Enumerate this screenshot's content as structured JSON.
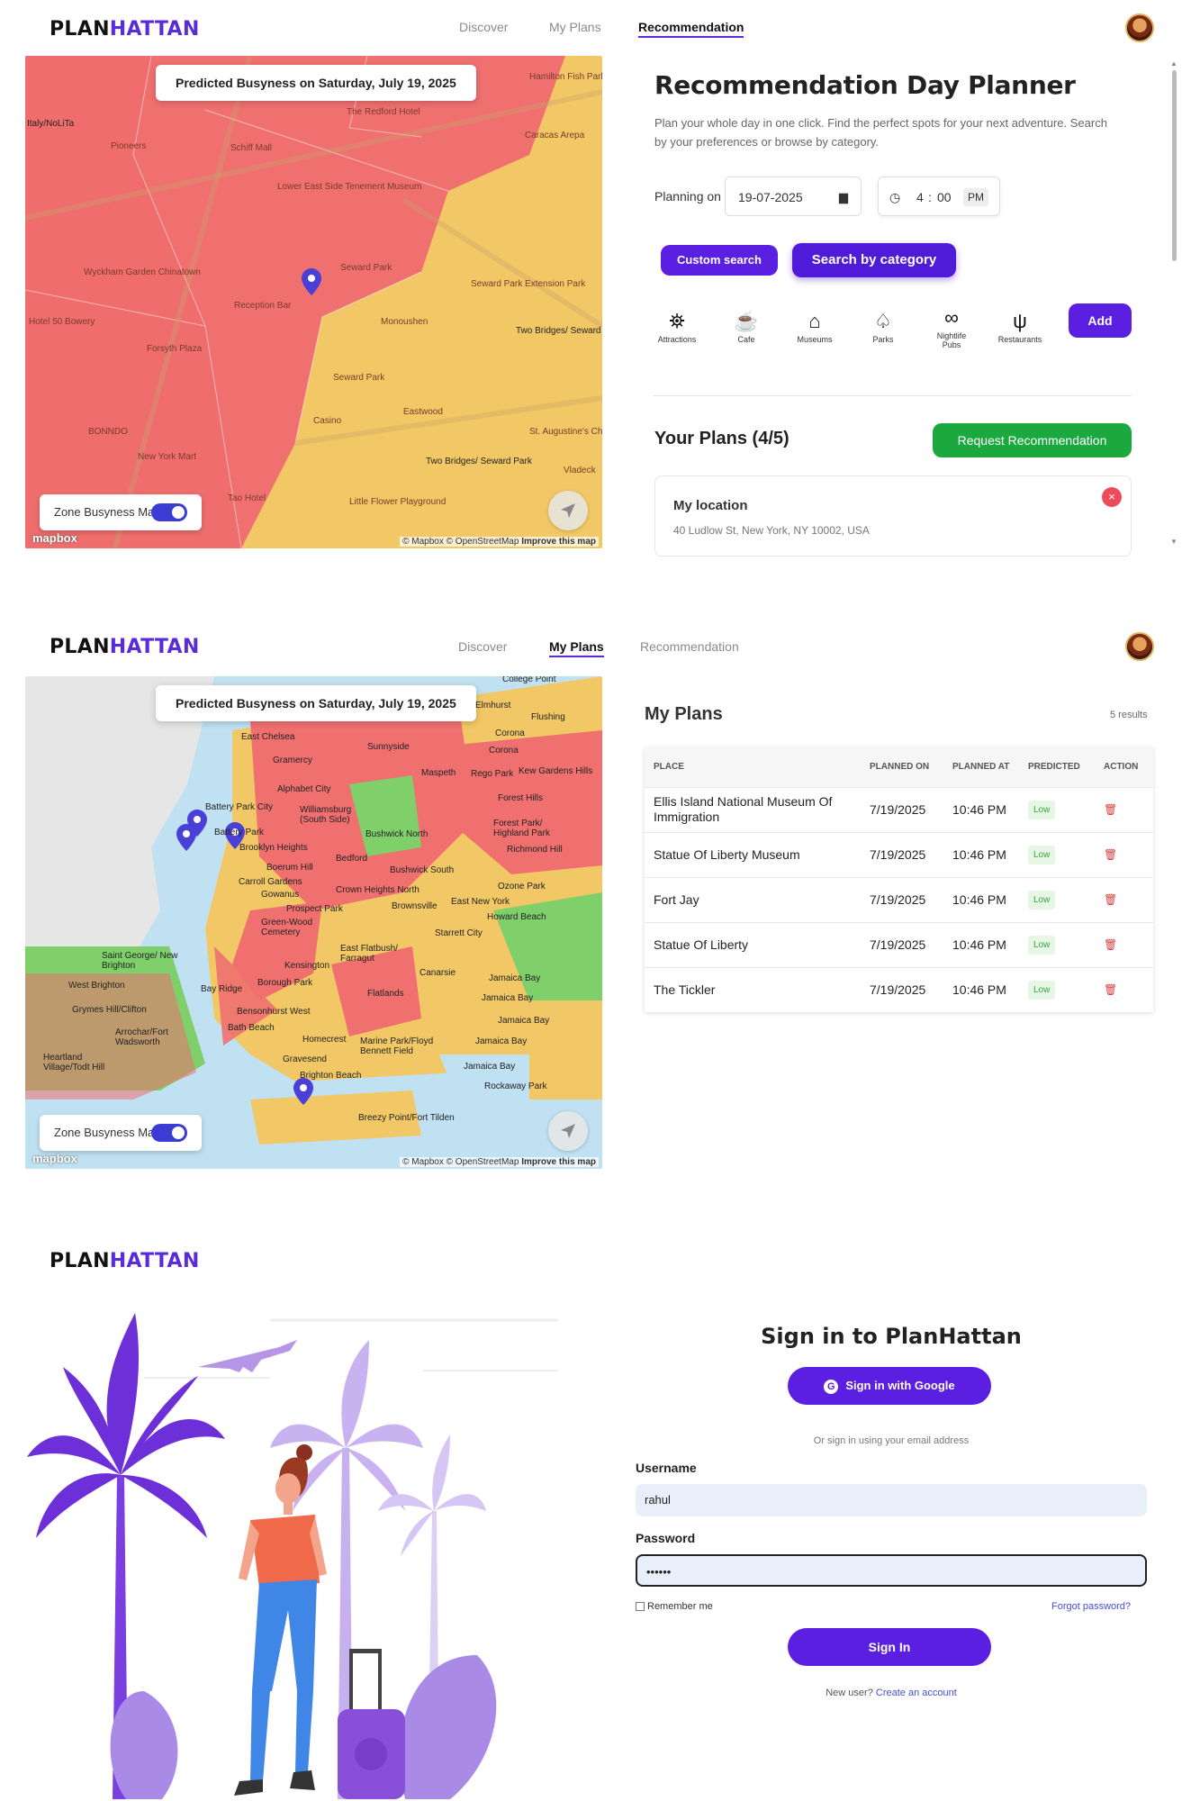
{
  "brand": {
    "part1": "PLAN",
    "part2": "HATTAN"
  },
  "nav": {
    "discover": "Discover",
    "my_plans": "My Plans",
    "recommendation": "Recommendation"
  },
  "map": {
    "busyness_label": "Predicted Busyness on Saturday, July 19, 2025",
    "toggle_label": "Zone Busyness Map",
    "attribution_mapbox": "© Mapbox",
    "attribution_osm": "© OpenStreetMap",
    "attribution_improve": "Improve this map",
    "logo": "mapbox",
    "map1_labels": [
      "Seward Park",
      "Monoushen",
      "Two Bridges/ Seward Park",
      "Forsyth Plaza",
      "Little Flower Playground",
      "Seward Park Extension Park",
      "Eastwood",
      "Casino",
      "St. Augustine's Church",
      "Two Bridges/ Seward Park",
      "Vladeck",
      "Schiff Mall",
      "The Redford Hotel",
      "Lower East Side Tenement Museum",
      "Wyckham Garden Chinatown",
      "New York Mart",
      "Reception Bar",
      "Hotel 50 Bowery",
      "BONNDO",
      "Pioneers",
      "Caracas Arepa",
      "Tao Hotel",
      "Italy/NoLiTa",
      "Hamilton Fish Park",
      "Seward Park"
    ],
    "map2_labels": [
      "College Point",
      "Elmhurst",
      "Flushing",
      "East Chelsea",
      "Corona",
      "Sunnyside",
      "Gramercy",
      "Corona",
      "Maspeth",
      "Rego Park",
      "Kew Gardens Hills",
      "Alphabet City",
      "Battery Park City",
      "Williamsburg (South Side)",
      "Forest Hills",
      "Battery Park",
      "Forest Park/ Highland Park",
      "Bushwick North",
      "Brooklyn Heights",
      "Richmond Hill",
      "Bedford",
      "Boerum Hill",
      "Bushwick South",
      "Carroll Gardens",
      "Gowanus",
      "Crown Heights North",
      "Ozone Park",
      "Prospect Park",
      "Brownsville",
      "East New York",
      "Green-Wood Cemetery",
      "Howard Beach",
      "Saint George/ New Brighton",
      "Starrett City",
      "East Flatbush/ Farragut",
      "Kensington",
      "Canarsie",
      "Borough Park",
      "Jamaica Bay",
      "West Brighton",
      "Bay Ridge",
      "Flatlands",
      "Jamaica Bay",
      "Grymes Hill/Clifton",
      "Bensonhurst West",
      "Bath Beach",
      "Jamaica Bay",
      "Arrochar/Fort Wadsworth",
      "Homecrest",
      "Marine Park/Floyd Bennett Field",
      "Jamaica Bay",
      "Heartland Village/Todt Hill",
      "Gravesend",
      "Brighton Beach",
      "Jamaica Bay",
      "Rockaway Park",
      "Breezy Point/Fort Tilden"
    ]
  },
  "planner": {
    "title": "Recommendation Day Planner",
    "subtitle": "Plan your whole day in one click. Find the perfect spots for your next adventure. Search by your preferences or browse by category.",
    "planning_on": "Planning on",
    "date": "19-07-2025",
    "time_hour": "4",
    "time_min": "00",
    "time_ampm": "PM",
    "custom_search": "Custom search",
    "search_by_category": "Search by category",
    "add": "Add",
    "categories": [
      {
        "label": "Attractions",
        "icon": "binoculars-icon"
      },
      {
        "label": "Cafe",
        "icon": "coffee-icon"
      },
      {
        "label": "Museums",
        "icon": "museum-icon"
      },
      {
        "label": "Parks",
        "icon": "tree-icon"
      },
      {
        "label": "Nightlife Pubs",
        "icon": "glasses-icon"
      },
      {
        "label": "Restaurants",
        "icon": "utensils-icon"
      }
    ],
    "your_plans": "Your Plans (4/5)",
    "request_recommendation": "Request Recommendation",
    "location_title": "My location",
    "location_address": "40 Ludlow St, New York, NY 10002, USA"
  },
  "my_plans": {
    "title": "My Plans",
    "results": "5 results",
    "headers": [
      "PLACE",
      "PLANNED ON",
      "PLANNED AT",
      "PREDICTED",
      "ACTION"
    ],
    "rows": [
      {
        "place": "Ellis Island National Museum Of Immigration",
        "on": "7/19/2025",
        "at": "10:46 PM",
        "predicted": "Low"
      },
      {
        "place": "Statue Of Liberty Museum",
        "on": "7/19/2025",
        "at": "10:46 PM",
        "predicted": "Low"
      },
      {
        "place": "Fort Jay",
        "on": "7/19/2025",
        "at": "10:46 PM",
        "predicted": "Low"
      },
      {
        "place": "Statue Of Liberty",
        "on": "7/19/2025",
        "at": "10:46 PM",
        "predicted": "Low"
      },
      {
        "place": "The Tickler",
        "on": "7/19/2025",
        "at": "10:46 PM",
        "predicted": "Low"
      }
    ]
  },
  "signin": {
    "title": "Sign in to PlanHattan",
    "google": "Sign in with Google",
    "or_text": "Or sign in using your email address",
    "username_label": "Username",
    "username_value": "rahul",
    "password_label": "Password",
    "password_value": "••••••",
    "remember": "Remember me",
    "forgot": "Forgot password?",
    "submit": "Sign In",
    "new_user": "New user?",
    "create": "Create an account"
  },
  "colors": {
    "brand_purple": "#5a2bd9",
    "green": "#1a9a3a",
    "busy_red": "#f07070",
    "busy_yellow": "#f2c866"
  }
}
